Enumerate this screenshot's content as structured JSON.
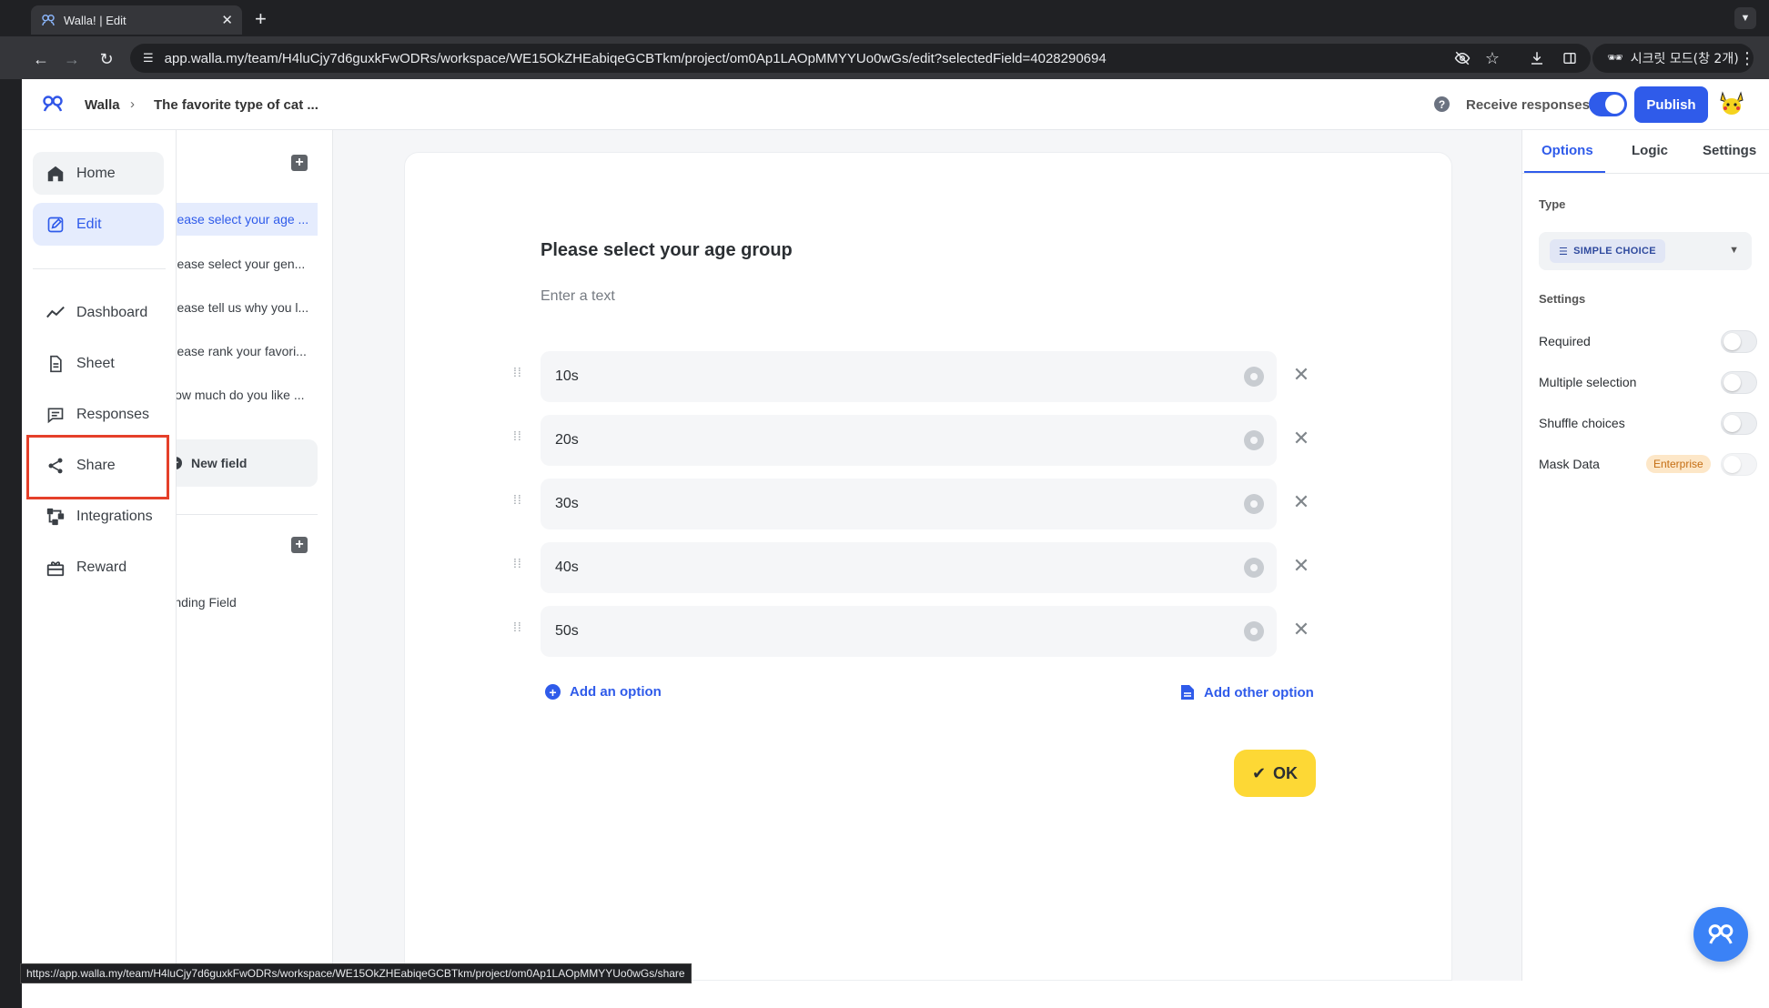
{
  "browser": {
    "tab_title": "Walla! | Edit",
    "new_tab_label": "+",
    "url": "app.walla.my/team/H4luCjy7d6guxkFwODRs/workspace/WE15OkZHEabiqeGCBTkm/project/om0Ap1LAOpMMYYUo0wGs/edit?selectedField=4028290694",
    "incognito_label": "시크릿 모드(창 2개)",
    "status_url": "https://app.walla.my/team/H4luCjy7d6guxkFwODRs/workspace/WE15OkZHEabiqeGCBTkm/project/om0Ap1LAOpMMYYUo0wGs/share"
  },
  "header": {
    "breadcrumb_home": "Walla",
    "breadcrumb_sep": "›",
    "breadcrumb_title": "The favorite type of cat ...",
    "help": "?",
    "receive_responses_label": "Receive responses",
    "receive_responses_on": true,
    "publish_label": "Publish"
  },
  "nav": {
    "items": [
      {
        "label": "Home",
        "icon": "home-icon"
      },
      {
        "label": "Edit",
        "icon": "edit-icon"
      },
      {
        "label": "Dashboard",
        "icon": "dashboard-icon"
      },
      {
        "label": "Sheet",
        "icon": "sheet-icon"
      },
      {
        "label": "Responses",
        "icon": "responses-icon"
      },
      {
        "label": "Share",
        "icon": "share-icon"
      },
      {
        "label": "Integrations",
        "icon": "integrations-icon"
      },
      {
        "label": "Reward",
        "icon": "reward-icon"
      }
    ],
    "active": "Edit",
    "highlighted": "Share"
  },
  "fields": {
    "items": [
      {
        "label": "Please select your age ..."
      },
      {
        "label": "Please select your gen..."
      },
      {
        "label": "Please tell us why you l..."
      },
      {
        "label": "Please rank your favori..."
      },
      {
        "label": "How much do you like ..."
      }
    ],
    "new_field_label": "New field",
    "ending_field_label": "Ending Field"
  },
  "question": {
    "title": "Please select your age group",
    "description_placeholder": "Enter a text",
    "options": [
      "10s",
      "20s",
      "30s",
      "40s",
      "50s"
    ],
    "add_option_label": "Add an option",
    "add_other_label": "Add other option",
    "ok_label": "OK"
  },
  "right_panel": {
    "tabs": [
      "Options",
      "Logic",
      "Settings"
    ],
    "active_tab": "Options",
    "type_label": "Type",
    "type_value": "SIMPLE CHOICE",
    "settings_label": "Settings",
    "settings": [
      {
        "label": "Required",
        "on": false
      },
      {
        "label": "Multiple selection",
        "on": false
      },
      {
        "label": "Shuffle choices",
        "on": false
      },
      {
        "label": "Mask Data",
        "on": false,
        "badge": "Enterprise"
      }
    ]
  },
  "colors": {
    "accent": "#2f5bea",
    "ok_button": "#fdd835",
    "highlight": "#e5402a",
    "enterprise_badge": "#fde7c8"
  }
}
